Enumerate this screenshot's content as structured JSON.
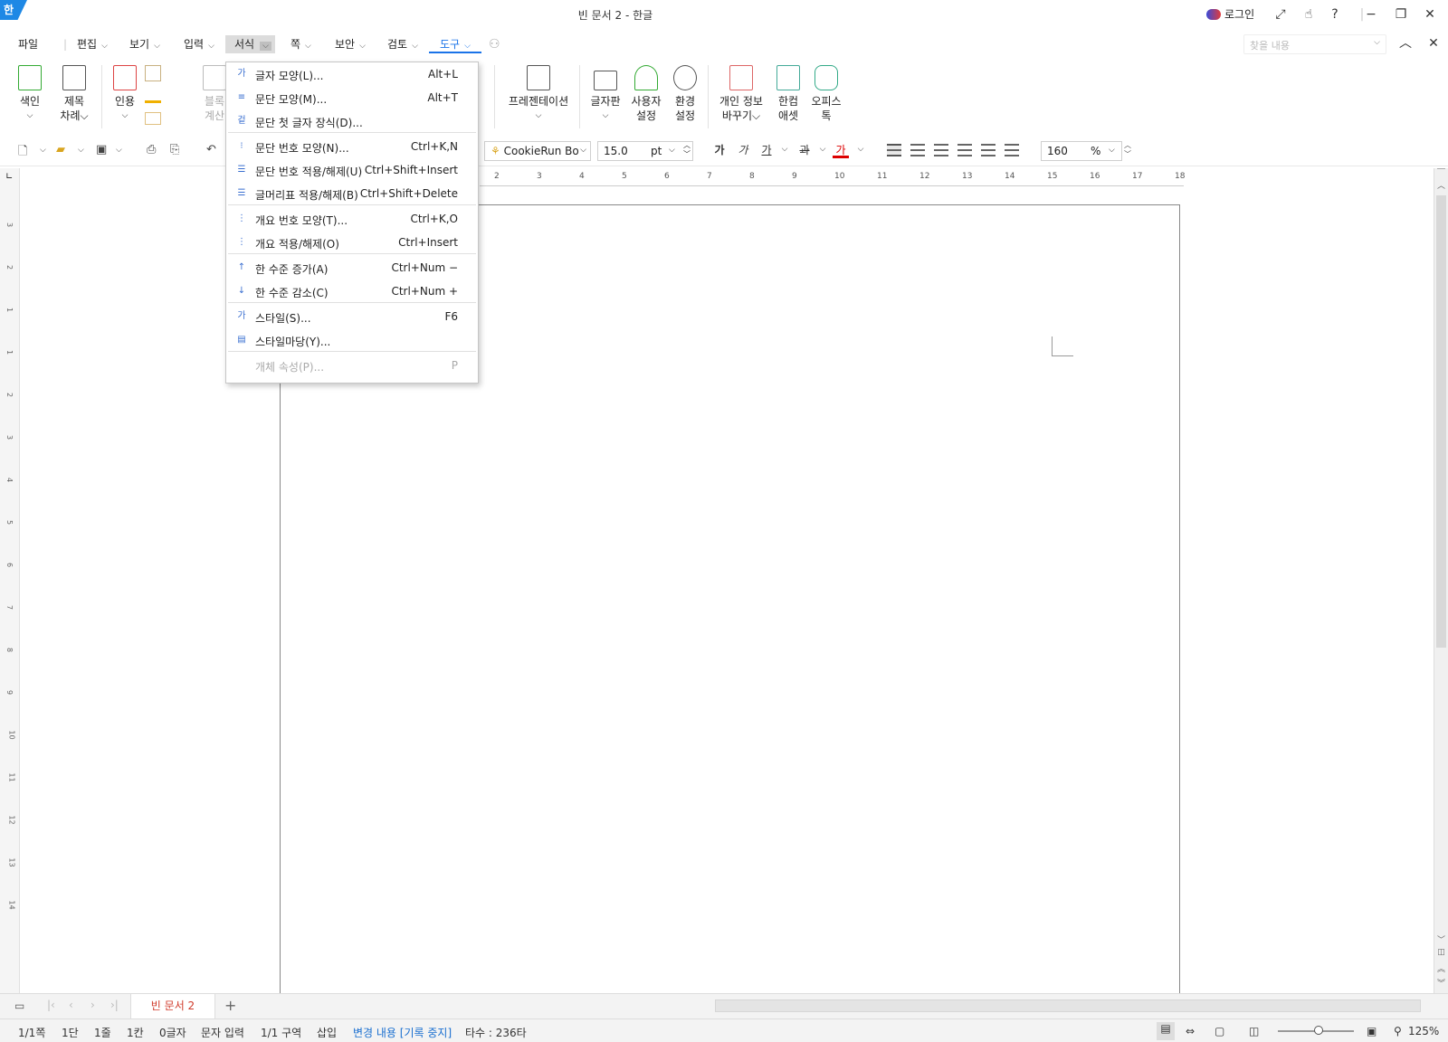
{
  "window": {
    "app_logo": "한",
    "title": "빈 문서 2 - 한글",
    "login_label": "로그인",
    "controls": [
      "⤢",
      "☝",
      "?",
      "—",
      "−",
      "❐",
      "✕"
    ]
  },
  "menubar": {
    "items": [
      {
        "label": "파일"
      },
      {
        "label": "편집",
        "chev": "⌵"
      },
      {
        "label": "보기",
        "chev": "⌵"
      },
      {
        "label": "입력",
        "chev": "⌵"
      },
      {
        "label": "서식",
        "chev": "⌵"
      },
      {
        "label": "쪽",
        "chev": "⌵"
      },
      {
        "label": "보안",
        "chev": "⌵"
      },
      {
        "label": "검토",
        "chev": "⌵"
      },
      {
        "label": "도구",
        "chev": "⌵"
      }
    ],
    "search_placeholder": "찾을 내용",
    "search_chev": "⌵",
    "collapse": "︿",
    "close": "✕"
  },
  "ribbon": {
    "index": {
      "line1": "색인",
      "line2": "⌵"
    },
    "toc": {
      "line1": "제목",
      "line2": "차례⌵"
    },
    "cite": {
      "line1": "인용",
      "line2": "⌵"
    },
    "block_calc": {
      "line1": "블록",
      "line2": "계산"
    },
    "presentation": {
      "line1": "프레젠테이션",
      "line2": "⌵"
    },
    "keyboard": {
      "line1": "글자판",
      "line2": "⌵"
    },
    "user_settings": {
      "line1": "사용자",
      "line2": "설정"
    },
    "env_settings": {
      "line1": "환경",
      "line2": "설정"
    },
    "privacy": {
      "line1": "개인 정보",
      "line2": "바꾸기⌵"
    },
    "hancom_asset": {
      "line1": "한컴",
      "line2": "애셋"
    },
    "office_talk": {
      "line1": "오피스",
      "line2": "톡"
    }
  },
  "toolbar": {
    "font_name": "CookieRun Bo",
    "font_size": "15.0",
    "size_unit": "pt",
    "line_spacing": "160",
    "spacing_unit": "%",
    "bold": "가",
    "italic": "가",
    "underline": "가",
    "strike": "과",
    "color": "가"
  },
  "ruler": {
    "top_ticks": [
      "2",
      "3",
      "4",
      "5",
      "6",
      "7",
      "8",
      "9",
      "10",
      "11",
      "12",
      "13",
      "14",
      "15",
      "16",
      "17",
      "18"
    ],
    "left_ticks": [
      "3",
      "2",
      "1",
      "1",
      "2",
      "3",
      "4",
      "5",
      "6",
      "7",
      "8",
      "9",
      "10",
      "11",
      "12",
      "13",
      "14"
    ]
  },
  "format_menu": {
    "items": [
      {
        "icon": "가",
        "label": "글자 모양(L)...",
        "shortcut": "Alt+L"
      },
      {
        "icon": "≡",
        "label": "문단 모양(M)...",
        "shortcut": "Alt+T"
      },
      {
        "icon": "겉",
        "label": "문단 첫 글자 장식(D)...",
        "shortcut": ""
      },
      {
        "icon": "⁝",
        "label": "문단 번호 모양(N)...",
        "shortcut": "Ctrl+K,N"
      },
      {
        "icon": "☰",
        "label": "문단 번호 적용/해제(U)",
        "shortcut": "Ctrl+Shift+Insert"
      },
      {
        "icon": "☰",
        "label": "글머리표 적용/해제(B)",
        "shortcut": "Ctrl+Shift+Delete"
      },
      {
        "icon": "⋮",
        "label": "개요 번호 모양(T)...",
        "shortcut": "Ctrl+K,O"
      },
      {
        "icon": "⋮",
        "label": "개요 적용/해제(O)",
        "shortcut": "Ctrl+Insert"
      },
      {
        "icon": "↑",
        "label": "한 수준 증가(A)",
        "shortcut": "Ctrl+Num −"
      },
      {
        "icon": "↓",
        "label": "한 수준 감소(C)",
        "shortcut": "Ctrl+Num +"
      },
      {
        "icon": "가",
        "label": "스타일(S)...",
        "shortcut": "F6"
      },
      {
        "icon": "▤",
        "label": "스타일마당(Y)...",
        "shortcut": ""
      },
      {
        "icon": "",
        "label": "개체 속성(P)...",
        "shortcut": "P"
      }
    ]
  },
  "tabs": {
    "doc_tab": "빈 문서 2",
    "add": "+"
  },
  "status": {
    "page": "1/1쪽",
    "column": "1단",
    "line": "1줄",
    "col": "1칸",
    "chars": "0글자",
    "mode": "문자 입력",
    "section": "1/1 구역",
    "insert": "삽입",
    "track": "변경 내용 [기록 중지]",
    "typing": "타수 : 236타",
    "zoom": "125%"
  }
}
